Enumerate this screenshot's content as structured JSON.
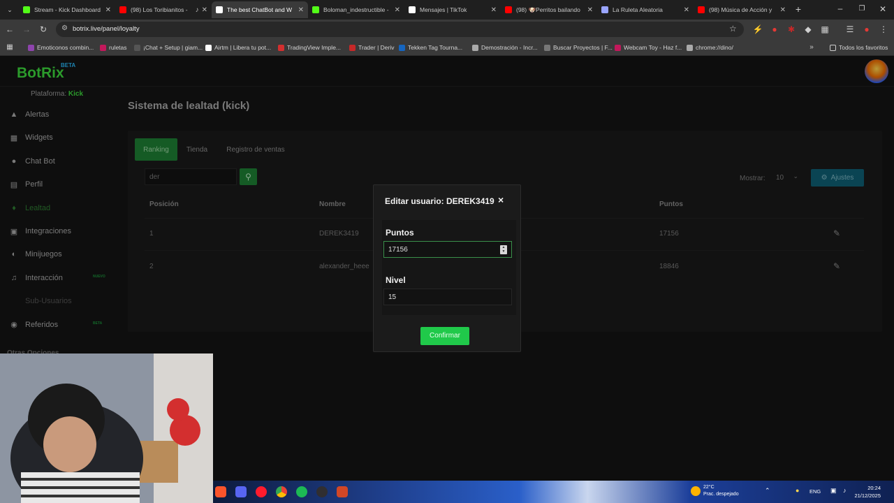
{
  "browser": {
    "tabs": [
      {
        "title": "Stream - Kick Dashboard",
        "favicon_color": "#53fc18"
      },
      {
        "title": "(98) Los Toribianitos -",
        "favicon_color": "#ff0000",
        "audio": true
      },
      {
        "title": "The best ChatBot and W",
        "favicon_color": "#ffffff",
        "active": true
      },
      {
        "title": "Boloman_indestructible -",
        "favicon_color": "#53fc18"
      },
      {
        "title": "Mensajes | TikTok",
        "favicon_color": "#ffffff"
      },
      {
        "title": "(98) 🐶Perritos bailando",
        "favicon_color": "#ff0000"
      },
      {
        "title": "La Ruleta Aleatoria",
        "favicon_color": "#9aa5ff"
      },
      {
        "title": "(98) Música de Acción y",
        "favicon_color": "#ff0000"
      }
    ],
    "url": "botrix.live/panel/loyalty",
    "bookmarks": [
      "Emoticonos combin...",
      "ruletas",
      "¡Chat + Setup | giam...",
      "Airtm | Libera tu pot...",
      "TradingView Imple...",
      "Trader | Deriv",
      "Tekken Tag Tourna...",
      "Demostración - Incr...",
      "Buscar Proyectos | F...",
      "Webcam Toy - Haz f...",
      "chrome://dino/"
    ],
    "all_bookmarks": "Todos los favoritos"
  },
  "app": {
    "logo": "BotRix",
    "logo_badge": "BETA",
    "platform_label": "Plataforma:",
    "platform_value": "Kick",
    "accent": "#3cd63c",
    "nav": [
      {
        "label": "Alertas",
        "icon": "alert-icon"
      },
      {
        "label": "Widgets",
        "icon": "widgets-icon"
      },
      {
        "label": "Chat Bot",
        "icon": "robot-icon"
      },
      {
        "label": "Perfil",
        "icon": "profile-icon"
      },
      {
        "label": "Lealtad",
        "icon": "gem-icon",
        "active": true
      },
      {
        "label": "Integraciones",
        "icon": "puzzle-icon"
      },
      {
        "label": "Minijuegos",
        "icon": "gamepad-icon"
      },
      {
        "label": "Interacción",
        "icon": "music-icon",
        "badge": "NUEVO"
      },
      {
        "label": "Sub-Usuarios",
        "icon": "",
        "disabled": true
      },
      {
        "label": "Referidos",
        "icon": "users-icon",
        "badge": "BETA"
      }
    ],
    "other_options": "Otras Opciones"
  },
  "loyalty": {
    "title": "Sistema de lealtad (kick)",
    "tabs": [
      "Ranking",
      "Tienda",
      "Registro de ventas"
    ],
    "search_value": "der",
    "show_label": "Mostrar:",
    "show_value": "10",
    "settings_label": "Ajustes",
    "columns": [
      "Posición",
      "Nombre",
      "Puntos"
    ],
    "rows": [
      {
        "position": "1",
        "name": "DEREK3419",
        "points": "17156"
      },
      {
        "position": "2",
        "name": "alexander_heee",
        "points": "18846"
      }
    ]
  },
  "modal": {
    "title": "Editar usuario: DEREK3419",
    "close": "×",
    "points_label": "Puntos",
    "points_value": "17156",
    "level_label": "Nivel",
    "level_value": "15",
    "confirm_label": "Confirmar"
  },
  "taskbar": {
    "weather_temp": "22°C",
    "weather_desc": "Prac. despejado",
    "lang": "ENG",
    "time": "20:24",
    "date": "21/12/2025"
  }
}
